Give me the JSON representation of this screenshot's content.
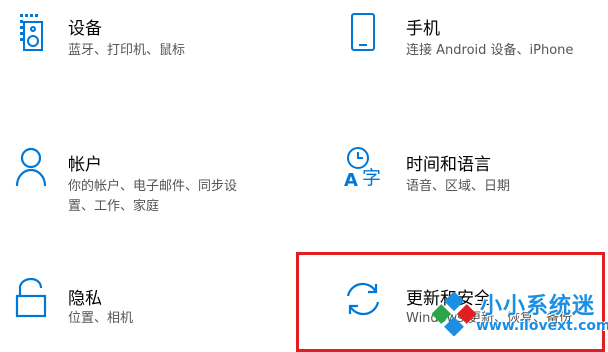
{
  "settings": {
    "devices": {
      "title": "设备",
      "desc": "蓝牙、打印机、鼠标",
      "icon": "devices-icon"
    },
    "phone": {
      "title": "手机",
      "desc": "连接 Android 设备、iPhone",
      "icon": "phone-icon"
    },
    "accounts": {
      "title": "帐户",
      "desc_line1": "你的帐户、电子邮件、同步设",
      "desc_line2": "置、工作、家庭",
      "icon": "person-icon"
    },
    "time_language": {
      "title": "时间和语言",
      "desc": "语音、区域、日期",
      "icon": "time-language-icon"
    },
    "privacy": {
      "title": "隐私",
      "desc": "位置、相机",
      "icon": "lock-icon"
    },
    "update_security": {
      "title": "更新和安全",
      "desc": "Windows 更新、恢复、备份",
      "icon": "sync-icon"
    }
  },
  "watermark": {
    "name": "小小系统迷",
    "url": "www.ilovext.com"
  },
  "colors": {
    "accent": "#0078d7",
    "highlight": "#e02020",
    "watermark": "#1a8fe3"
  }
}
